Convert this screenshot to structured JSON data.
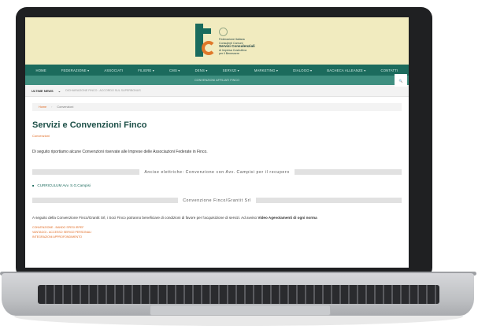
{
  "site": {
    "logo": {
      "lines": [
        "Federazione Italiana",
        "Consulenti Camuni",
        "Servizi Consulenziali",
        "di Impresa Costruttiva",
        "per il Benessere"
      ]
    },
    "nav": [
      "HOME",
      "FEDERAZIONE ▾",
      "ASSOCIATI",
      "FILIERE ▾",
      "CMS ▾",
      "DENS ▾",
      "SERVIZI ▾",
      "MARKETING ▾",
      "DIALOGO ▾",
      "BACHECA ALLEANZE ▾",
      "CONTATTI"
    ],
    "subnav_text": "CONVENZIONI AFFILIATI FINCO",
    "search_icon": "🔍",
    "ticker": {
      "label": "ULTIME NEWS",
      "arrow": "⌄",
      "text": "DICHIARAZIONE FINCO - ACCORDO SUL SUPERBONUS"
    },
    "breadcrumb": {
      "home": "Home",
      "sep": "›",
      "current": "Convenzioni"
    },
    "page": {
      "title": "Servizi e Convenzioni Finco",
      "subtitle": "Convenzioni",
      "intro": "Di seguito riportiamo alcune Convenzioni riservate alle Imprese delle Associazioni Federate in Finco.",
      "sections": [
        {
          "heading": "Ancise elettriche: Convenzione con Avv. Campisi per il recupero"
        },
        {
          "heading": "Convenzione Finco/Grantit Srl"
        }
      ],
      "list_item": "CURRICULUM Avv. S.G.Campisi",
      "paragraph_text": "A seguito della Convenzione Finco/Grantit Srl, i Soci Finco potranno beneficiare di condizioni di favore per l'acquisizione di servizi. Ad avviso",
      "paragraph_bold": "Video Agevolamenti di ogni norma",
      "orange_list": [
        "CONVENZIONE - BANDO SPESI IRPEF",
        "VANTAGGI - ACCESSO SERVIZI PERSONALI",
        "INTEGRAZIONI APPROFONDIMENTO"
      ]
    }
  }
}
